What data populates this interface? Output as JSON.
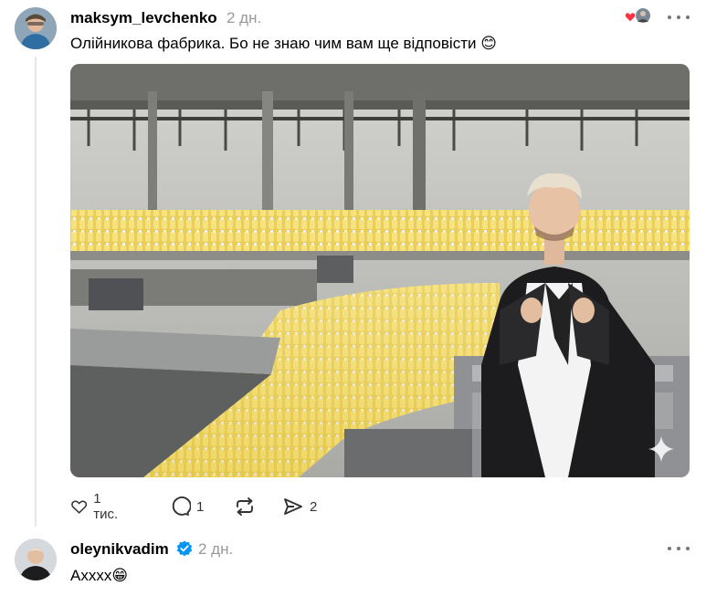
{
  "post": {
    "username": "maksym_levchenko",
    "time": "2 дн.",
    "text": "Олійникова фабрика. Бо не знаю чим вам ще відповісти",
    "emoji": "😊",
    "actions": {
      "likes": "1 тис.",
      "replies": "1",
      "shares": "2"
    }
  },
  "reply": {
    "username": "oleynikvadim",
    "time": "2 дн.",
    "text": "Ахххх",
    "emoji": "😁"
  },
  "colors": {
    "verified": "#0095f6",
    "like_badge": "#ff3040",
    "muted": "#999999"
  },
  "icons": [
    "heart-icon",
    "comment-icon",
    "repost-icon",
    "share-icon",
    "more-icon",
    "verified-icon",
    "sparkle-icon"
  ]
}
